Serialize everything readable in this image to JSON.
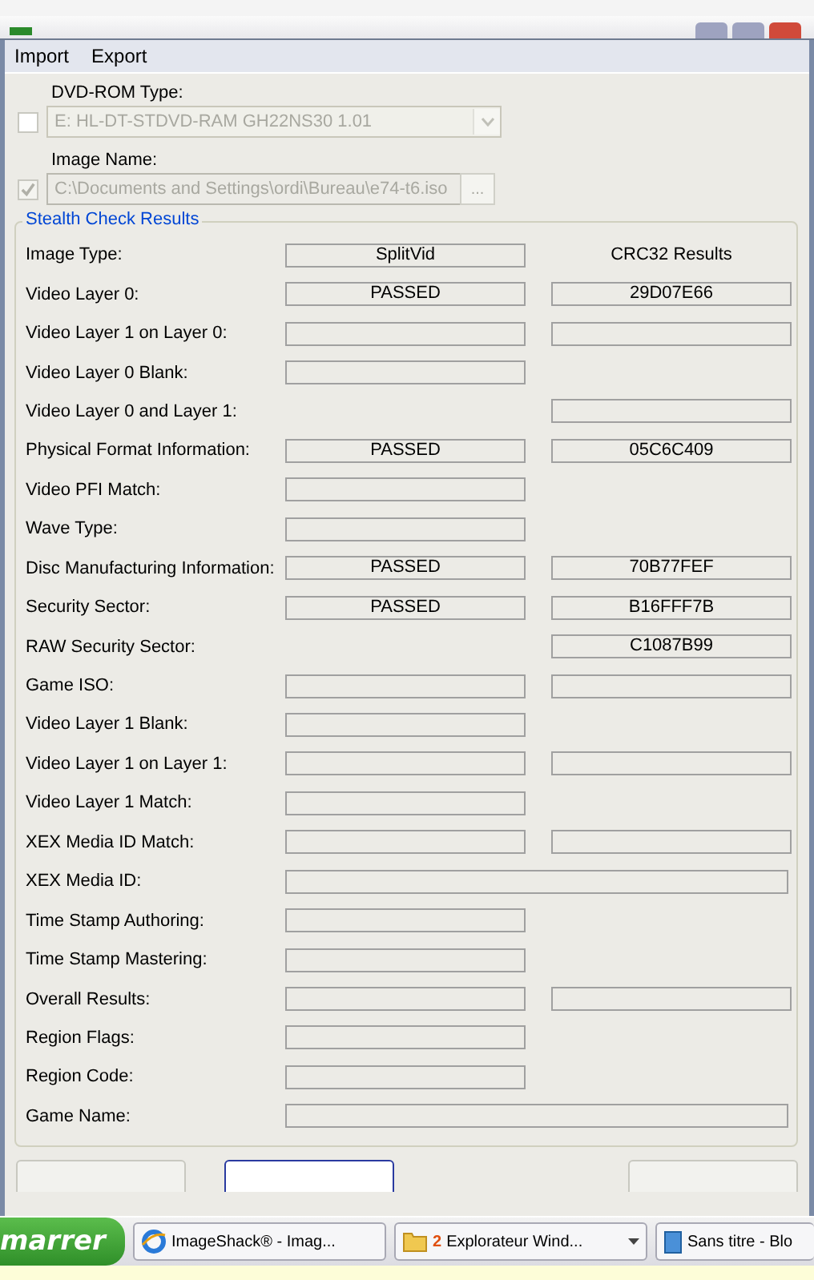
{
  "menu": [
    "Import",
    "Export"
  ],
  "dvd_rom": {
    "label": "DVD-ROM Type:",
    "checked": false,
    "value": "E: HL-DT-STDVD-RAM GH22NS30 1.01"
  },
  "image_name": {
    "label": "Image Name:",
    "checked": true,
    "value": "C:\\Documents and Settings\\ordi\\Bureau\\e74-t6.iso",
    "browse": "..."
  },
  "results": {
    "title": "Stealth Check Results",
    "rows": [
      {
        "label": "Image Type:",
        "kind": "header",
        "status": "SplitVid",
        "header": "CRC32 Results"
      },
      {
        "label": "Video Layer 0:",
        "kind": "both",
        "status": "PASSED",
        "crc": "29D07E66"
      },
      {
        "label": "Video Layer 1 on Layer 0:",
        "kind": "both"
      },
      {
        "label": "Video Layer 0 Blank:",
        "kind": "status"
      },
      {
        "label": "Video Layer 0 and Layer 1:",
        "kind": "crc"
      },
      {
        "label": "Physical Format Information:",
        "kind": "both",
        "status": "PASSED",
        "crc": "05C6C409"
      },
      {
        "label": "Video PFI Match:",
        "kind": "status"
      },
      {
        "label": "Wave Type:",
        "kind": "status"
      },
      {
        "label": "Disc Manufacturing Information:",
        "kind": "both",
        "status": "PASSED",
        "crc": "70B77FEF"
      },
      {
        "label": "Security Sector:",
        "kind": "both",
        "status": "PASSED",
        "crc": "B16FFF7B"
      },
      {
        "label": "RAW Security Sector:",
        "kind": "crc",
        "crc": "C1087B99"
      },
      {
        "label": "Game ISO:",
        "kind": "both"
      },
      {
        "label": "Video Layer 1 Blank:",
        "kind": "status"
      },
      {
        "label": "Video Layer 1 on Layer 1:",
        "kind": "both"
      },
      {
        "label": "Video Layer 1 Match:",
        "kind": "status"
      },
      {
        "label": "XEX Media ID Match:",
        "kind": "both"
      },
      {
        "label": "XEX Media ID:",
        "kind": "wide"
      },
      {
        "label": "Time Stamp Authoring:",
        "kind": "status"
      },
      {
        "label": "Time Stamp Mastering:",
        "kind": "status"
      },
      {
        "label": "Overall Results:",
        "kind": "both"
      },
      {
        "label": "Region Flags:",
        "kind": "status"
      },
      {
        "label": "Region Code:",
        "kind": "status"
      },
      {
        "label": "Game Name:",
        "kind": "wide"
      }
    ]
  },
  "taskbar": {
    "start": "marrer",
    "tasks": [
      {
        "label": "ImageShack® - Imag..."
      },
      {
        "count": "2",
        "label": "Explorateur Wind...",
        "dropdown": true
      },
      {
        "label": "Sans titre - Blo"
      }
    ]
  }
}
